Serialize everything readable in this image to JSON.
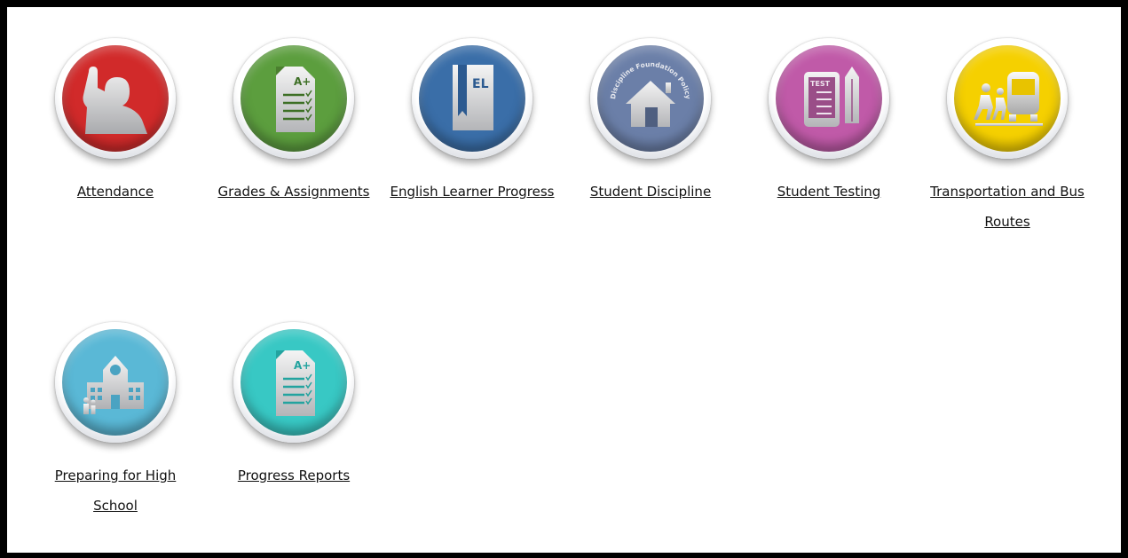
{
  "tiles": [
    {
      "label": "Attendance",
      "color": "#d12a2a",
      "icon": "person-raising-hand-icon"
    },
    {
      "label": "Grades & Assignments",
      "color": "#5c9e3e",
      "icon": "graded-paper-icon"
    },
    {
      "label": "English Learner Progress",
      "color": "#3a6ea8",
      "icon": "el-book-icon"
    },
    {
      "label": "Student Discipline",
      "color": "#6b7fa8",
      "icon": "house-icon",
      "badge_text": "Discipline Foundation Policy"
    },
    {
      "label": "Student Testing",
      "color": "#c05aa8",
      "icon": "test-tablet-pencil-icon"
    },
    {
      "label": "Transportation and Bus Routes",
      "color": "#f5d000",
      "icon": "children-bus-icon"
    },
    {
      "label": "Preparing for High School",
      "color": "#5ab8d6",
      "icon": "school-building-icon"
    },
    {
      "label": "Progress Reports",
      "color": "#38c8c4",
      "icon": "graded-paper-icon"
    }
  ],
  "icon_fill": "#d9dadc",
  "icon_stroke": "#6a6a6a"
}
